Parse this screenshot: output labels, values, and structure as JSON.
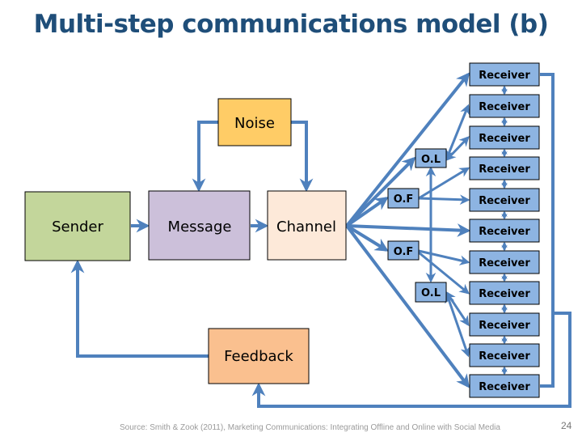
{
  "title": "Multi-step communications model (b)",
  "colors": {
    "title": "#1F4E79",
    "arrow": "#4F81BD",
    "sender": "#C3D69B",
    "message": "#CCC0DA",
    "channel": "#FDE9D9",
    "noise": "#FFCC66",
    "feedback": "#FAC08F",
    "receiver": "#8DB4E2",
    "opinion": "#8DB4E2"
  },
  "nodes": {
    "sender": "Sender",
    "message": "Message",
    "channel": "Channel",
    "noise": "Noise",
    "feedback": "Feedback"
  },
  "opinion_nodes": [
    {
      "id": "ol-top",
      "label": "O.L"
    },
    {
      "id": "of-top",
      "label": "O.F"
    },
    {
      "id": "of-bottom",
      "label": "O.F"
    },
    {
      "id": "ol-bottom",
      "label": "O.L"
    }
  ],
  "receivers": [
    "Receiver",
    "Receiver",
    "Receiver",
    "Receiver",
    "Receiver",
    "Receiver",
    "Receiver",
    "Receiver",
    "Receiver",
    "Receiver",
    "Receiver"
  ],
  "footer": {
    "source": "Source: Smith & Zook (2011), Marketing Communications: Integrating Offline and Online with Social Media",
    "page_number": "24"
  }
}
